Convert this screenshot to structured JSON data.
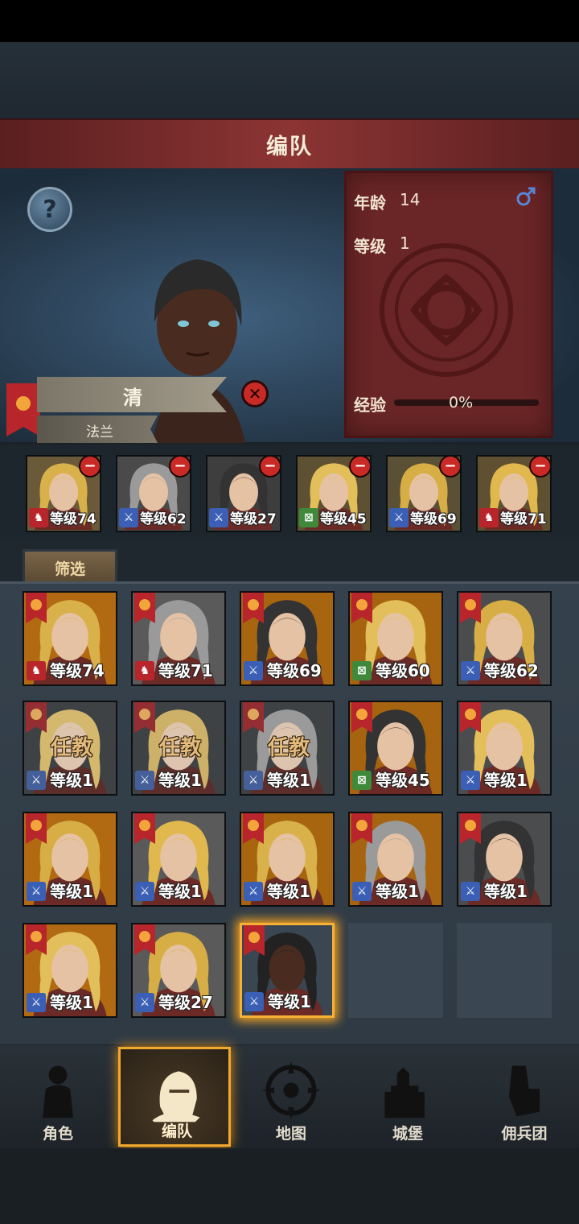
{
  "header": {
    "title": "编队"
  },
  "character": {
    "name": "清",
    "origin": "法兰",
    "age_label": "年龄",
    "age": "14",
    "gender_icon": "male-symbol-icon",
    "level_label": "等级",
    "level": "1",
    "xp_label": "经验",
    "xp_percent": "0%",
    "xp_fraction": 0
  },
  "team": [
    {
      "level": "等级74",
      "type": "cavalry"
    },
    {
      "level": "等级62",
      "type": "sword"
    },
    {
      "level": "等级27",
      "type": "sword"
    },
    {
      "level": "等级45",
      "type": "archer"
    },
    {
      "level": "等级69",
      "type": "sword"
    },
    {
      "level": "等级71",
      "type": "cavalry"
    }
  ],
  "filter": {
    "label": "筛选"
  },
  "roster": [
    {
      "level": "等级74",
      "type": "cavalry",
      "task": ""
    },
    {
      "level": "等级71",
      "type": "cavalry",
      "task": ""
    },
    {
      "level": "等级69",
      "type": "sword",
      "task": ""
    },
    {
      "level": "等级60",
      "type": "archer",
      "task": ""
    },
    {
      "level": "等级62",
      "type": "sword",
      "task": ""
    },
    {
      "level": "等级1",
      "type": "sword",
      "task": "任教"
    },
    {
      "level": "等级1",
      "type": "sword",
      "task": "任教"
    },
    {
      "level": "等级1",
      "type": "sword",
      "task": "任教"
    },
    {
      "level": "等级45",
      "type": "archer",
      "task": ""
    },
    {
      "level": "等级1",
      "type": "sword",
      "task": ""
    },
    {
      "level": "等级1",
      "type": "sword",
      "task": ""
    },
    {
      "level": "等级1",
      "type": "sword",
      "task": ""
    },
    {
      "level": "等级1",
      "type": "sword",
      "task": ""
    },
    {
      "level": "等级1",
      "type": "sword",
      "task": ""
    },
    {
      "level": "等级1",
      "type": "sword",
      "task": ""
    },
    {
      "level": "等级1",
      "type": "sword",
      "task": ""
    },
    {
      "level": "等级27",
      "type": "sword",
      "task": ""
    },
    {
      "level": "等级1",
      "type": "sword",
      "task": "",
      "selected": true
    }
  ],
  "nav": [
    {
      "label": "角色",
      "icon": "knight-icon"
    },
    {
      "label": "编队",
      "icon": "helmet-icon",
      "active": true
    },
    {
      "label": "地图",
      "icon": "compass-icon"
    },
    {
      "label": "城堡",
      "icon": "castle-icon"
    },
    {
      "label": "佣兵团",
      "icon": "fist-icon"
    }
  ],
  "colors": {
    "title_bar": "#8c3434",
    "stat_card": "#6a2526",
    "badge_cavalry": "#b8252a",
    "badge_sword": "#3a5fb5",
    "badge_archer": "#3f8a3a",
    "selected_glow": "#f7b135"
  }
}
